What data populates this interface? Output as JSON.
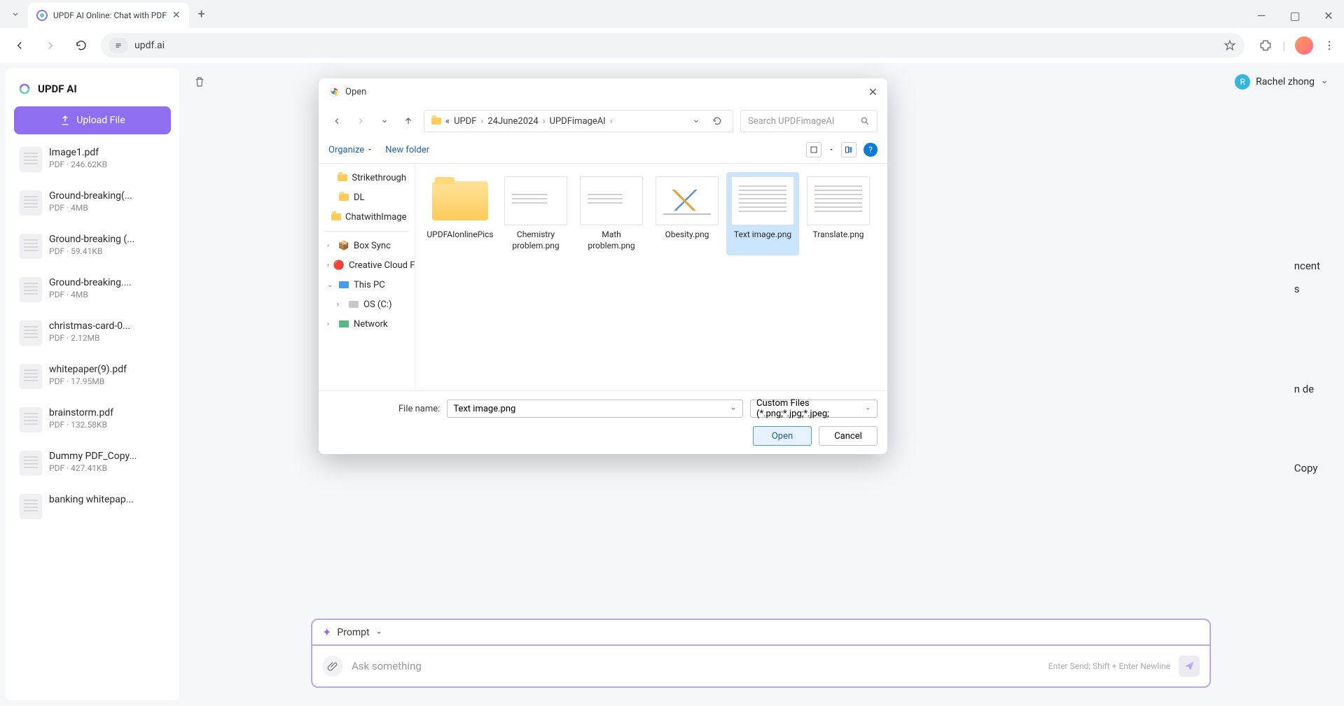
{
  "browser": {
    "tab_title": "UPDF AI Online: Chat with PDF",
    "url": "updf.ai"
  },
  "brand": {
    "name": "UPDF AI"
  },
  "upload_label": "Upload File",
  "user": {
    "initial": "R",
    "name": "Rachel zhong"
  },
  "files": [
    {
      "name": "Image1.pdf",
      "sub": "PDF · 246.62KB"
    },
    {
      "name": "Ground-breaking(...",
      "sub": "PDF · 4MB"
    },
    {
      "name": "Ground-breaking (...",
      "sub": "PDF · 59.41KB"
    },
    {
      "name": "Ground-breaking....",
      "sub": "PDF · 4MB"
    },
    {
      "name": "christmas-card-0...",
      "sub": "PDF · 2.12MB"
    },
    {
      "name": "whitepaper(9).pdf",
      "sub": "PDF · 17.95MB"
    },
    {
      "name": "brainstorm.pdf",
      "sub": "PDF · 132.58KB"
    },
    {
      "name": "Dummy PDF_Copy...",
      "sub": "PDF · 427.41KB"
    },
    {
      "name": "banking whitepap...",
      "sub": ""
    }
  ],
  "prompt": {
    "label": "Prompt",
    "placeholder": "Ask something",
    "hint": "Enter Send; Shift + Enter Newline"
  },
  "bg_text": {
    "r1": "ncent",
    "r2": "s",
    "r3": "n de",
    "r4": "Copy"
  },
  "dialog": {
    "title": "Open",
    "breadcrumb_prefix": "«",
    "breadcrumb": [
      "UPDF",
      "24June2024",
      "UPDFimageAI"
    ],
    "search_placeholder": "Search UPDFimageAI",
    "organize": "Organize",
    "new_folder": "New folder",
    "tree": {
      "strikethrough": "Strikethrough",
      "dl": "DL",
      "chatwithimage": "ChatwithImage",
      "box_sync": "Box Sync",
      "creative_cloud": "Creative Cloud F",
      "this_pc": "This PC",
      "os_c": "OS (C:)",
      "network": "Network"
    },
    "grid": [
      {
        "label": "UPDFAIonlinePics",
        "type": "folder"
      },
      {
        "label": "Chemistry problem.png",
        "type": "short-lines"
      },
      {
        "label": "Math problem.png",
        "type": "short-lines"
      },
      {
        "label": "Obesity.png",
        "type": "chart"
      },
      {
        "label": "Text image.png",
        "type": "text-lines",
        "selected": true
      },
      {
        "label": "Translate.png",
        "type": "text-lines"
      }
    ],
    "file_name_label": "File name:",
    "file_name_value": "Text image.png",
    "filter": "Custom Files (*.png;*.jpg;*.jpeg;",
    "open_btn": "Open",
    "cancel_btn": "Cancel"
  }
}
